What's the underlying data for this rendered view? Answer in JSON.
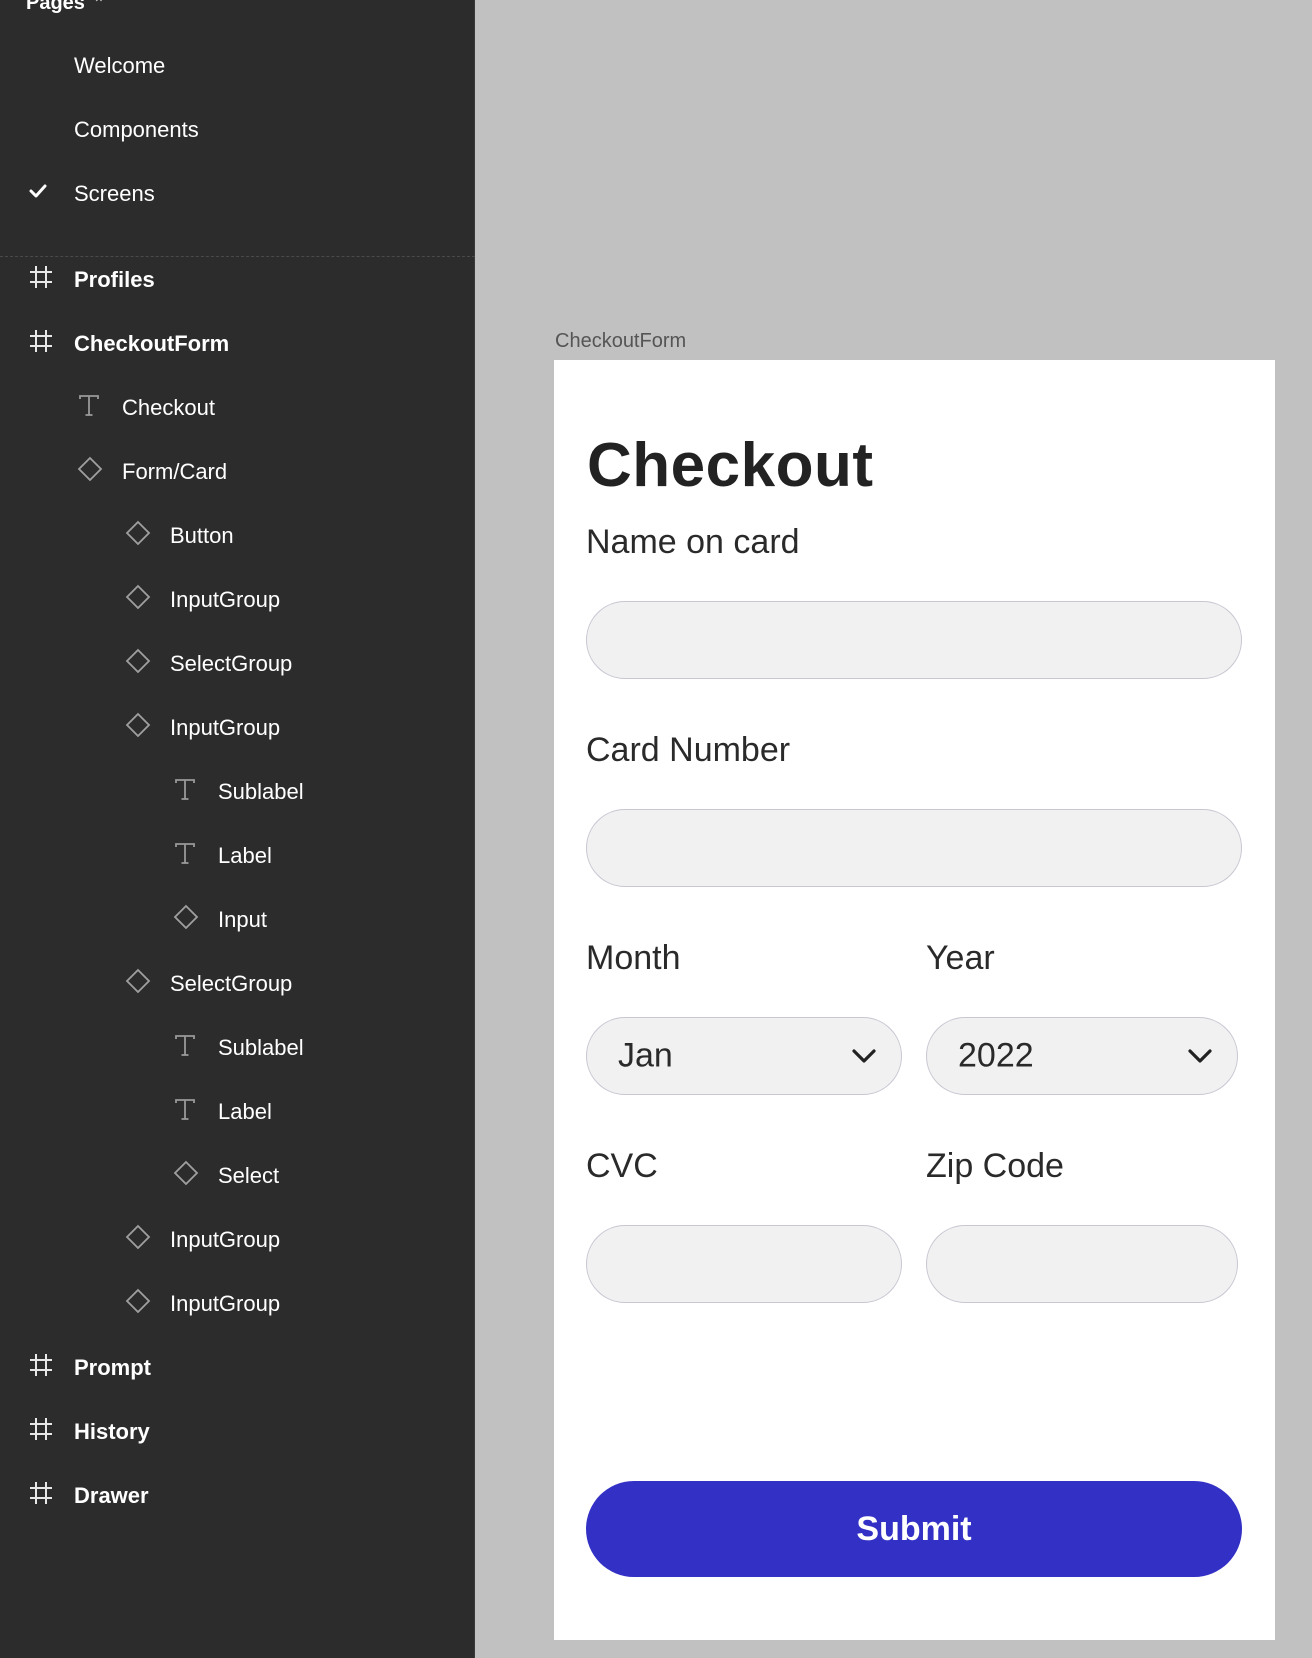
{
  "sidebar": {
    "pages_header": "Pages",
    "pages": [
      {
        "label": "Welcome",
        "selected": false
      },
      {
        "label": "Components",
        "selected": false
      },
      {
        "label": "Screens",
        "selected": true
      }
    ],
    "layers": [
      {
        "label": "Profiles",
        "icon": "frame-icon",
        "bold": true
      },
      {
        "label": "CheckoutForm",
        "icon": "frame-icon",
        "bold": true
      },
      {
        "label": "Checkout",
        "icon": "text-icon",
        "bold": false
      },
      {
        "label": "Form/Card",
        "icon": "component-icon",
        "bold": false
      },
      {
        "label": "Button",
        "icon": "component-icon",
        "bold": false
      },
      {
        "label": "InputGroup",
        "icon": "component-icon",
        "bold": false
      },
      {
        "label": "SelectGroup",
        "icon": "component-icon",
        "bold": false
      },
      {
        "label": "InputGroup",
        "icon": "component-icon",
        "bold": false
      },
      {
        "label": "Sublabel",
        "icon": "text-icon",
        "bold": false
      },
      {
        "label": "Label",
        "icon": "text-icon",
        "bold": false
      },
      {
        "label": "Input",
        "icon": "component-icon",
        "bold": false
      },
      {
        "label": "SelectGroup",
        "icon": "component-icon",
        "bold": false
      },
      {
        "label": "Sublabel",
        "icon": "text-icon",
        "bold": false
      },
      {
        "label": "Label",
        "icon": "text-icon",
        "bold": false
      },
      {
        "label": "Select",
        "icon": "component-icon",
        "bold": false
      },
      {
        "label": "InputGroup",
        "icon": "component-icon",
        "bold": false
      },
      {
        "label": "InputGroup",
        "icon": "component-icon",
        "bold": false
      },
      {
        "label": "Prompt",
        "icon": "frame-icon",
        "bold": true
      },
      {
        "label": "History",
        "icon": "frame-icon",
        "bold": true
      },
      {
        "label": "Drawer",
        "icon": "frame-icon",
        "bold": true
      }
    ]
  },
  "canvas": {
    "frame_name": "CheckoutForm",
    "form": {
      "title": "Checkout",
      "name_label": "Name on card",
      "name_value": "",
      "card_label": "Card Number",
      "card_value": "",
      "month_label": "Month",
      "month_value": "Jan",
      "year_label": "Year",
      "year_value": "2022",
      "cvc_label": "CVC",
      "cvc_value": "",
      "zip_label": "Zip Code",
      "zip_value": "",
      "submit_label": "Submit"
    }
  },
  "colors": {
    "sidebar_bg": "#2c2c2c",
    "canvas_bg": "#c1c1c1",
    "button_bg": "#3330c5",
    "input_bg": "#f1f1f1"
  }
}
